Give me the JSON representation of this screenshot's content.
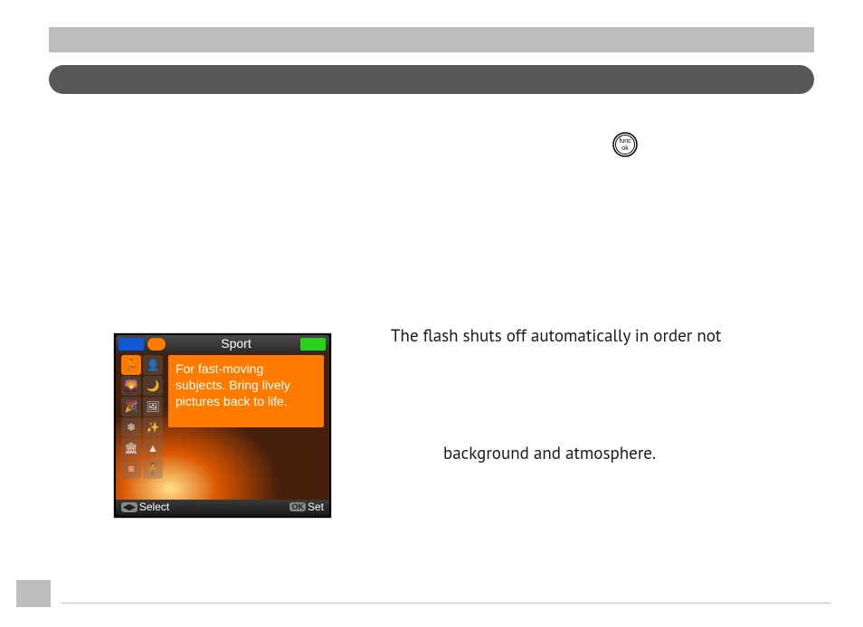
{
  "funcOk": {
    "top": "func",
    "bottom": "ok"
  },
  "screen": {
    "mode_label": "Sport",
    "tooltip": "For fast-moving subjects. Bring lively pictures back to life.",
    "bottom_left_key": "◀▶",
    "bottom_left_label": "Select",
    "bottom_right_key": "OK",
    "bottom_right_label": "Set"
  },
  "paragraphs": {
    "p1": "The flash shuts off automatically in order not",
    "p2": "background and atmosphere."
  }
}
